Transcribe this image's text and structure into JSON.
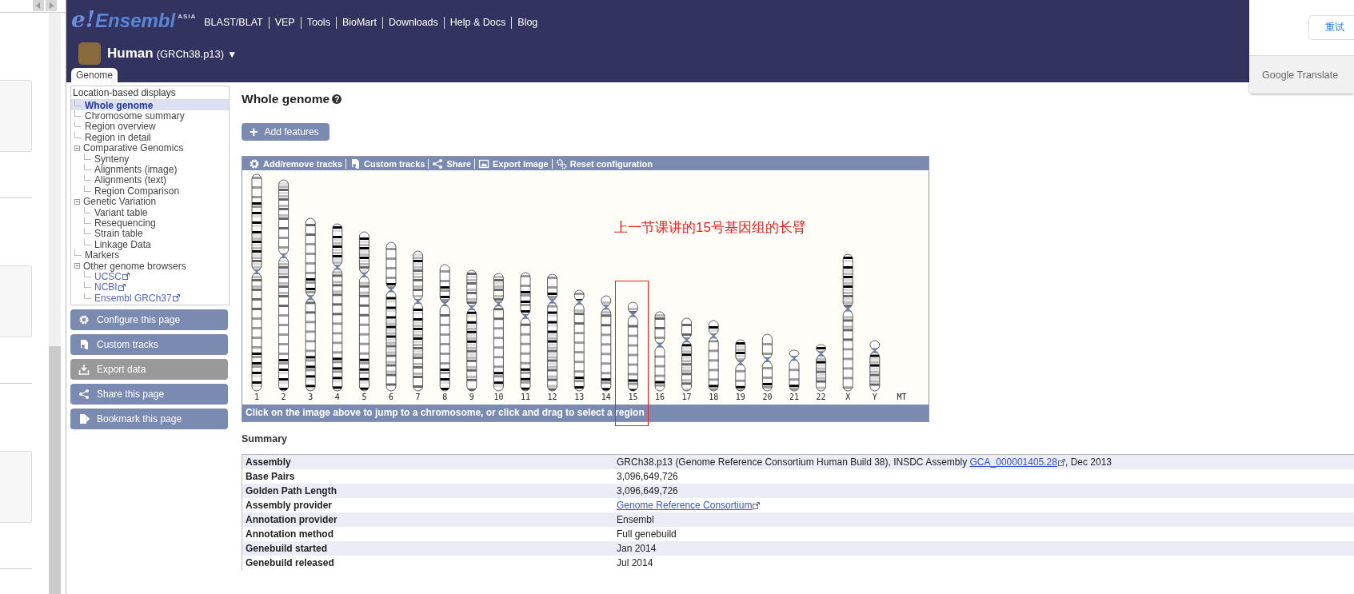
{
  "header": {
    "logo": {
      "mark": "e!",
      "name": "Ensembl",
      "region": "ASIA"
    },
    "nav": [
      "BLAST/BLAT",
      "VEP",
      "Tools",
      "BioMart",
      "Downloads",
      "Help & Docs",
      "Blog"
    ],
    "species": {
      "name": "Human",
      "assembly": "(GRCh38.p13)",
      "caret": "▼"
    },
    "tabs": [
      {
        "label": "Genome",
        "selected": true
      }
    ]
  },
  "sidebar": {
    "title": "Location-based displays",
    "items": [
      {
        "label": "Whole genome",
        "kind": "page",
        "selected": true
      },
      {
        "label": "Chromosome summary",
        "kind": "page",
        "selected": false
      },
      {
        "label": "Region overview",
        "kind": "page",
        "selected": false
      },
      {
        "label": "Region in detail",
        "kind": "page",
        "selected": false
      },
      {
        "label": "Comparative Genomics",
        "kind": "page",
        "selected": false,
        "expanded": true,
        "children": [
          {
            "label": "Synteny",
            "kind": "page",
            "selected": false
          },
          {
            "label": "Alignments (image)",
            "kind": "page",
            "selected": false
          },
          {
            "label": "Alignments (text)",
            "kind": "page",
            "selected": false
          },
          {
            "label": "Region Comparison",
            "kind": "page",
            "selected": false
          }
        ]
      },
      {
        "label": "Genetic Variation",
        "kind": "page",
        "selected": false,
        "expanded": true,
        "children": [
          {
            "label": "Variant table",
            "kind": "page",
            "selected": false
          },
          {
            "label": "Resequencing",
            "kind": "page",
            "selected": false
          },
          {
            "label": "Strain table",
            "kind": "page",
            "selected": false
          },
          {
            "label": "Linkage Data",
            "kind": "page",
            "selected": false
          }
        ]
      },
      {
        "label": "Markers",
        "kind": "page",
        "selected": false
      },
      {
        "label": "Other genome browsers",
        "kind": "page",
        "selected": false,
        "expanded": true,
        "children": [
          {
            "label": "UCSC",
            "kind": "external",
            "selected": false
          },
          {
            "label": "NCBI",
            "kind": "external",
            "selected": false
          },
          {
            "label": "Ensembl GRCh37",
            "kind": "external",
            "selected": false
          }
        ]
      }
    ],
    "buttons": [
      {
        "label": "Configure this page",
        "disabled": false
      },
      {
        "label": "Custom tracks",
        "disabled": false
      },
      {
        "label": "Export data",
        "disabled": true
      },
      {
        "label": "Share this page",
        "disabled": false
      },
      {
        "label": "Bookmark this page",
        "disabled": false
      }
    ]
  },
  "main": {
    "title": "Whole genome",
    "help": "?",
    "add_button": "+ Add features",
    "karyotype": {
      "toolbar": [
        "Add/remove tracks",
        "Custom tracks",
        "Share",
        "Export image",
        "Reset configuration"
      ],
      "chromosomes": [
        {
          "label": "1",
          "highlighted": false
        },
        {
          "label": "2",
          "highlighted": false
        },
        {
          "label": "3",
          "highlighted": false
        },
        {
          "label": "4",
          "highlighted": false
        },
        {
          "label": "5",
          "highlighted": false
        },
        {
          "label": "6",
          "highlighted": false
        },
        {
          "label": "7",
          "highlighted": false
        },
        {
          "label": "8",
          "highlighted": false
        },
        {
          "label": "9",
          "highlighted": false
        },
        {
          "label": "10",
          "highlighted": false
        },
        {
          "label": "11",
          "highlighted": false
        },
        {
          "label": "12",
          "highlighted": false
        },
        {
          "label": "13",
          "highlighted": false
        },
        {
          "label": "14",
          "highlighted": false
        },
        {
          "label": "15",
          "highlighted": true
        },
        {
          "label": "16",
          "highlighted": false
        },
        {
          "label": "17",
          "highlighted": false
        },
        {
          "label": "18",
          "highlighted": false
        },
        {
          "label": "19",
          "highlighted": false
        },
        {
          "label": "20",
          "highlighted": false
        },
        {
          "label": "21",
          "highlighted": false
        },
        {
          "label": "22",
          "highlighted": false
        },
        {
          "label": "X",
          "highlighted": false
        },
        {
          "label": "Y",
          "highlighted": false
        },
        {
          "label": "MT",
          "highlighted": false
        }
      ],
      "footer": "Click on the image above to jump to a chromosome, or click and drag to select a region",
      "annotation": {
        "text": "上一节课讲的15号基因组的长臂"
      }
    },
    "summary": {
      "title": "Summary",
      "rows": [
        {
          "label": "Assembly",
          "value": [
            {
              "kind": "text",
              "text": "GRCh38.p13 (Genome Reference Consortium Human Build 38), INSDC Assembly "
            },
            {
              "kind": "link",
              "text": "GCA_000001405.28"
            },
            {
              "kind": "text",
              "text": ", Dec 2013"
            }
          ]
        },
        {
          "label": "Base Pairs",
          "value": [
            {
              "kind": "text",
              "text": "3,096,649,726"
            }
          ]
        },
        {
          "label": "Golden Path Length",
          "value": [
            {
              "kind": "text",
              "text": "3,096,649,726"
            }
          ]
        },
        {
          "label": "Assembly provider",
          "value": [
            {
              "kind": "link",
              "text": "Genome Reference Consortium"
            }
          ]
        },
        {
          "label": "Annotation provider",
          "value": [
            {
              "kind": "text",
              "text": "Ensembl"
            }
          ]
        },
        {
          "label": "Annotation method",
          "value": [
            {
              "kind": "text",
              "text": "Full genebuild"
            }
          ]
        },
        {
          "label": "Genebuild started",
          "value": [
            {
              "kind": "text",
              "text": "Jan 2014"
            }
          ]
        },
        {
          "label": "Genebuild released",
          "value": [
            {
              "kind": "text",
              "text": "Jul 2014"
            }
          ]
        }
      ]
    }
  },
  "translate_popup": {
    "button": "重试",
    "footer": "Google Translate"
  }
}
